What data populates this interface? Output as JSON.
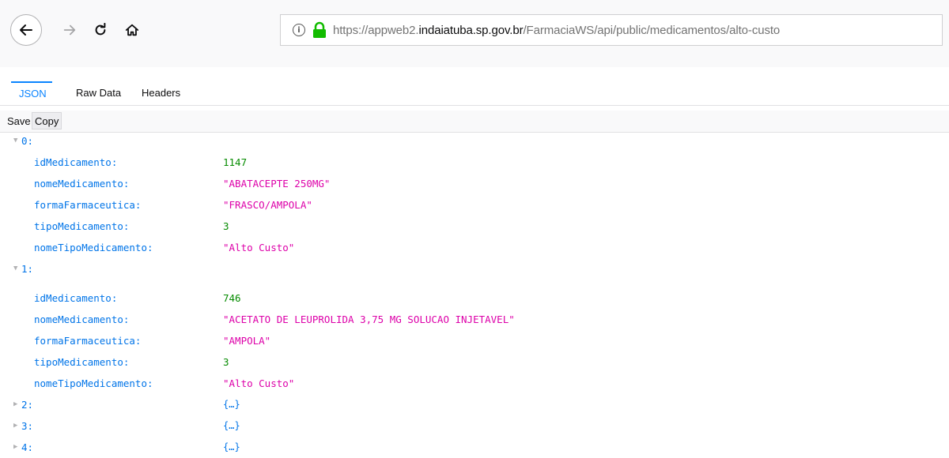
{
  "browser": {
    "url_prefix": "https://appweb2.",
    "url_domain": "indaiatuba.sp.gov.br",
    "url_path": "/FarmaciaWS/api/public/medicamentos/alto-custo",
    "info_glyph": "i",
    "icons": {
      "back": "back-arrow-icon",
      "forward": "forward-arrow-icon",
      "reload": "reload-icon",
      "home": "home-icon",
      "info": "info-icon",
      "lock": "lock-icon"
    }
  },
  "viewer": {
    "tabs": [
      "JSON",
      "Raw Data",
      "Headers"
    ],
    "actions": {
      "save": "Save",
      "copy": "Copy"
    }
  },
  "json": {
    "items": [
      {
        "index": "0:",
        "fields": [
          {
            "key": "idMedicamento:",
            "value": "1147"
          },
          {
            "key": "nomeMedicamento:",
            "value": "\"ABATACEPTE 250MG\""
          },
          {
            "key": "formaFarmaceutica:",
            "value": "\"FRASCO/AMPOLA\""
          },
          {
            "key": "tipoMedicamento:",
            "value": "3"
          },
          {
            "key": "nomeTipoMedicamento:",
            "value": "\"Alto Custo\""
          }
        ]
      },
      {
        "index": "1:",
        "fields": [
          {
            "key": "idMedicamento:",
            "value": "746"
          },
          {
            "key": "nomeMedicamento:",
            "value": "\"ACETATO DE LEUPROLIDA 3,75 MG SOLUCAO INJETAVEL\""
          },
          {
            "key": "formaFarmaceutica:",
            "value": "\"AMPOLA\""
          },
          {
            "key": "tipoMedicamento:",
            "value": "3"
          },
          {
            "key": "nomeTipoMedicamento:",
            "value": "\"Alto Custo\""
          }
        ]
      }
    ],
    "collapsed": [
      {
        "index": "2:",
        "preview": "{…}"
      },
      {
        "index": "3:",
        "preview": "{…}"
      },
      {
        "index": "4:",
        "preview": "{…}"
      }
    ],
    "colors": {
      "key": "#0074e8",
      "number": "#058b00",
      "string": "#dd00a9"
    }
  }
}
